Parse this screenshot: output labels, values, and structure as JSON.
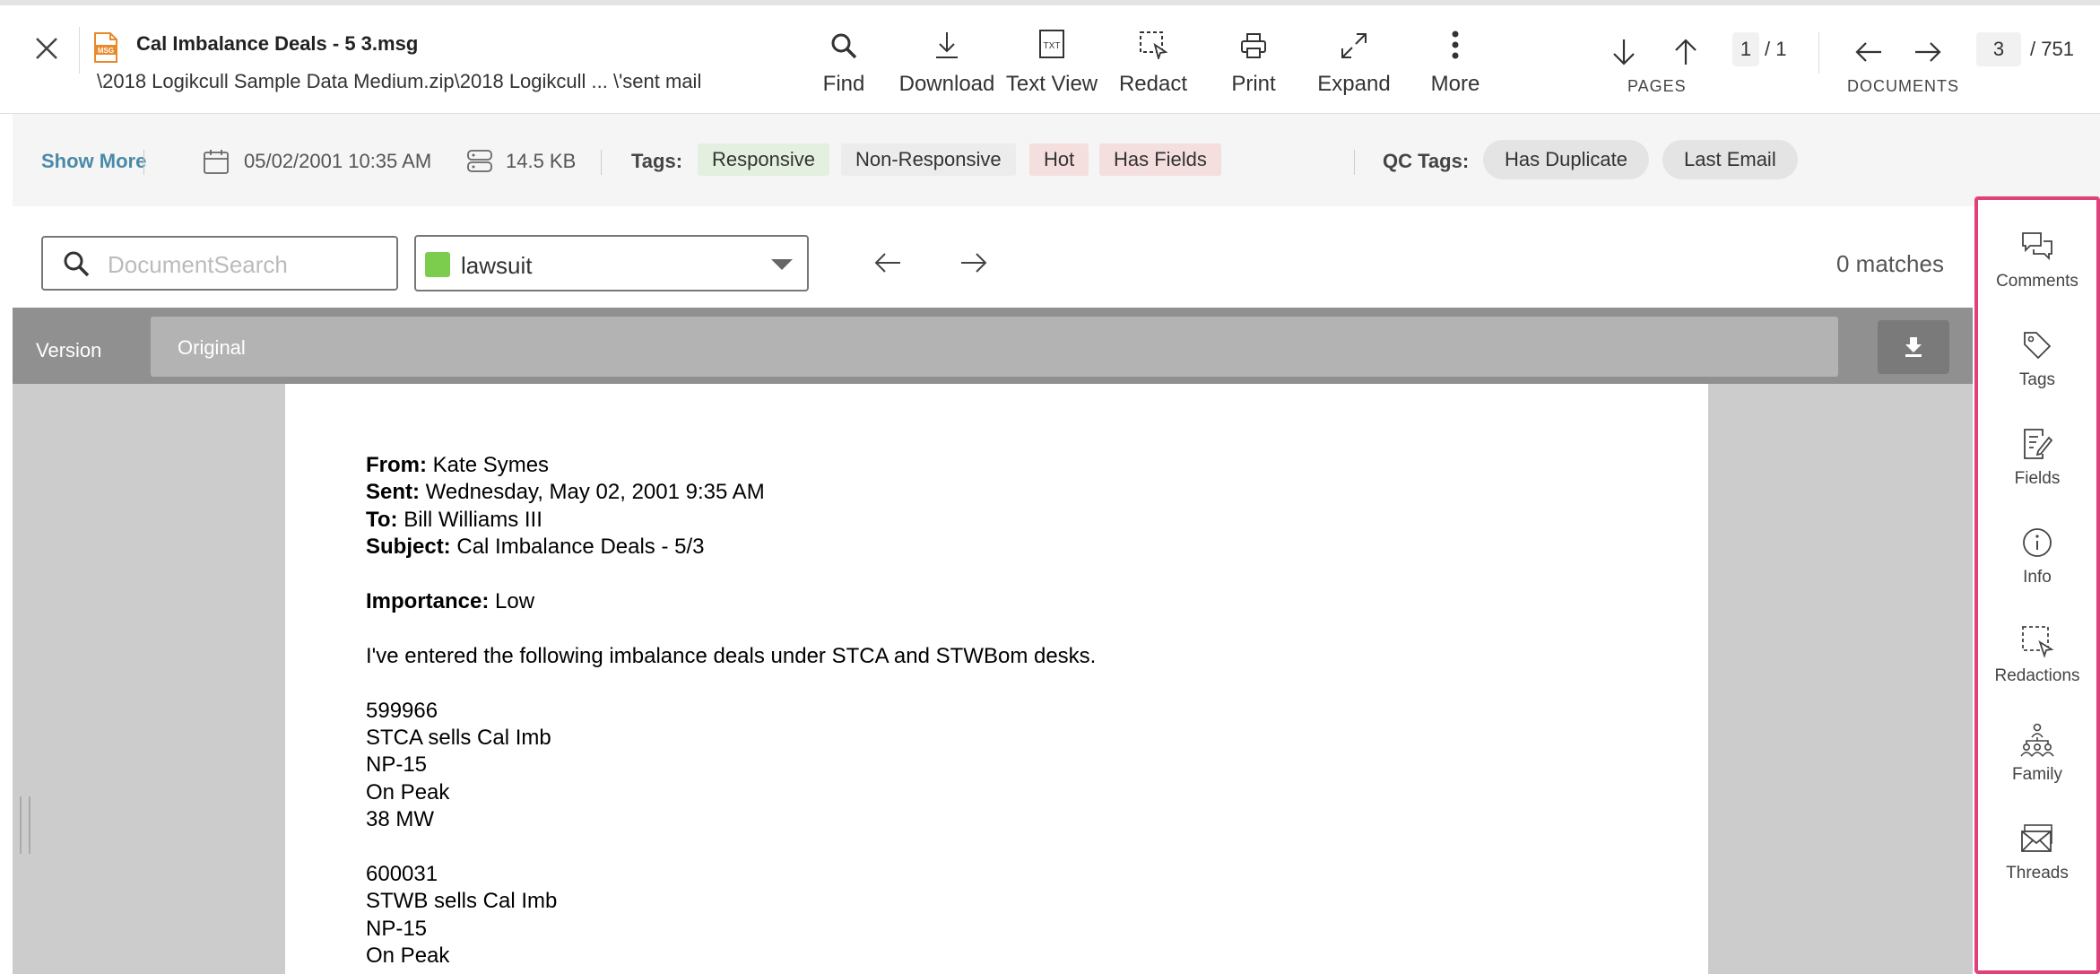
{
  "header": {
    "title": "Cal Imbalance Deals - 5 3.msg",
    "path": "\\2018 Logikcull Sample Data Medium.zip\\2018 Logikcull ... \\'sent mail",
    "toolbar": {
      "find": "Find",
      "download": "Download",
      "text_view": "Text View",
      "redact": "Redact",
      "print": "Print",
      "expand": "Expand",
      "more": "More"
    },
    "pages": {
      "current": "1",
      "total": "/ 1",
      "label": "PAGES"
    },
    "documents": {
      "current": "3",
      "total": "/ 751",
      "label": "DOCUMENTS"
    }
  },
  "infobar": {
    "show_more": "Show More",
    "date": "05/02/2001 10:35 AM",
    "size": "14.5 KB",
    "tags_label": "Tags:",
    "tags": [
      {
        "label": "Responsive",
        "color": "#e3f0df"
      },
      {
        "label": "Non-Responsive",
        "color": "#ececec"
      },
      {
        "label": "Hot",
        "color": "#f5dede"
      },
      {
        "label": "Has Fields",
        "color": "#f5dede"
      }
    ],
    "qc_label": "QC Tags:",
    "qc_tags": [
      "Has Duplicate",
      "Last Email"
    ]
  },
  "search": {
    "placeholder": "DocumentSearch",
    "term_list": "lawsuit",
    "term_color": "#7ccd4e",
    "matches": "0 matches"
  },
  "viewer": {
    "version_label": "Version",
    "version_value": "Original"
  },
  "email": {
    "from_label": "From:",
    "from": "Kate Symes",
    "sent_label": "Sent:",
    "sent": "Wednesday, May 02, 2001 9:35 AM",
    "to_label": "To:",
    "to": "Bill Williams III",
    "subject_label": "Subject:",
    "subject": "Cal Imbalance Deals - 5/3",
    "importance_label": "Importance:",
    "importance": "Low",
    "intro": "I've entered the following imbalance deals under STCA and STWBom desks.",
    "deal1": [
      "599966",
      "STCA sells Cal Imb",
      "NP-15",
      "On Peak",
      "38 MW"
    ],
    "deal2": [
      "600031",
      "STWB sells Cal Imb",
      "NP-15",
      "On Peak"
    ]
  },
  "sidepanel": {
    "comments": "Comments",
    "tags": "Tags",
    "fields": "Fields",
    "info": "Info",
    "redactions": "Redactions",
    "family": "Family",
    "threads": "Threads"
  },
  "colors": {
    "accent_link": "#4a8aa8",
    "panel_highlight": "#e0417a",
    "file_icon": "#e8892a"
  }
}
